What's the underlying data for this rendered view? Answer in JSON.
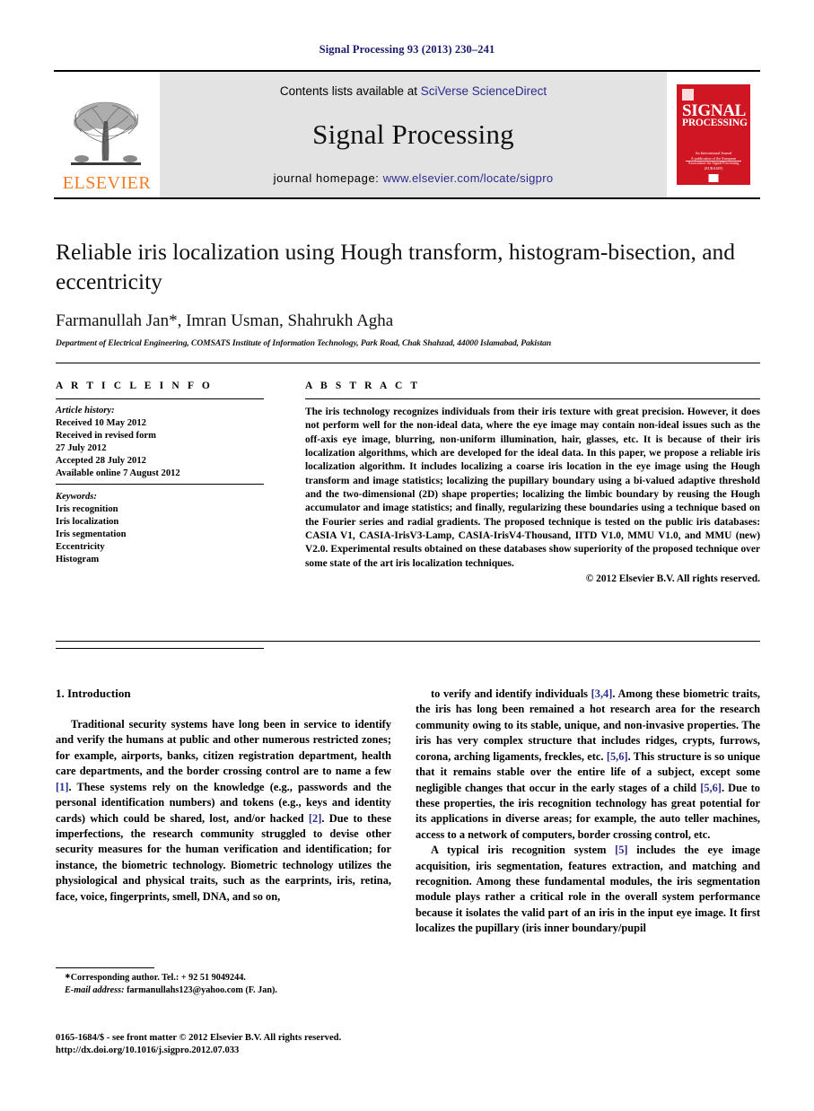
{
  "running_head": "Signal Processing 93 (2013) 230–241",
  "masthead": {
    "logo_word": "ELSEVIER",
    "contents_prefix": "Contents lists available at ",
    "contents_link": "SciVerse ScienceDirect",
    "journal_name": "Signal Processing",
    "homepage_prefix": "journal homepage: ",
    "homepage_url": "www.elsevier.com/locate/sigpro",
    "cover": {
      "line1": "SIGNAL",
      "line2": "PROCESSING",
      "subtitle": "An International Journal",
      "publisher": "A publication of the European Association for Signal Processing (EURASIP)"
    },
    "accent_orange": "#F47B20",
    "cover_red": "#cf1622",
    "link_blue": "#2b2b8f"
  },
  "title": "Reliable iris localization using Hough transform, histogram-bisection, and eccentricity",
  "authors": "Farmanullah Jan*, Imran Usman, Shahrukh Agha",
  "affiliation": "Department of Electrical Engineering, COMSATS Institute of Information Technology, Park Road, Chak Shahzad, 44000 Islamabad, Pakistan",
  "article_info": {
    "heading": "A R T I C L E  I N F O",
    "history_label": "Article history:",
    "history": [
      "Received 10 May 2012",
      "Received in revised form",
      "27 July 2012",
      "Accepted 28 July 2012",
      "Available online 7 August 2012"
    ],
    "keywords_label": "Keywords:",
    "keywords": [
      "Iris recognition",
      "Iris localization",
      "Iris segmentation",
      "Eccentricity",
      "Histogram"
    ]
  },
  "abstract": {
    "heading": "A B S T R A C T",
    "text": "The iris technology recognizes individuals from their iris texture with great precision. However, it does not perform well for the non-ideal data, where the eye image may contain non-ideal issues such as the off-axis eye image, blurring, non-uniform illumination, hair, glasses, etc. It is because of their iris localization algorithms, which are developed for the ideal data. In this paper, we propose a reliable iris localization algorithm. It includes localizing a coarse iris location in the eye image using the Hough transform and image statistics; localizing the pupillary boundary using a bi-valued adaptive threshold and the two-dimensional (2D) shape properties; localizing the limbic boundary by reusing the Hough accumulator and image statistics; and finally, regularizing these boundaries using a technique based on the Fourier series and radial gradients. The proposed technique is tested on the public iris databases: CASIA V1, CASIA-IrisV3-Lamp, CASIA-IrisV4-Thousand, IITD V1.0, MMU V1.0, and MMU (new) V2.0. Experimental results obtained on these databases show superiority of the proposed technique over some state of the art iris localization techniques.",
    "copyright": "© 2012 Elsevier B.V. All rights reserved."
  },
  "body": {
    "section_number_title": "1.  Introduction",
    "left_paragraphs": [
      {
        "runs": [
          {
            "t": "Traditional security systems have long been in service to identify and verify the humans at public and other numerous restricted zones; for example, airports, banks, citizen registration department, health care departments, and the border crossing control are to name a few "
          },
          {
            "t": "[1]",
            "ref": true
          },
          {
            "t": ". These systems rely on the knowledge (e.g., passwords and the personal identification numbers) and tokens (e.g., keys and identity cards) which could be shared, lost, and/or hacked "
          },
          {
            "t": "[2]",
            "ref": true
          },
          {
            "t": ". Due to these imperfections, the research community struggled to devise other security measures for the human verification and identification; for instance, the biometric technology. Biometric technology utilizes the physiological and physical traits, such as the earprints, iris, retina, face, voice, fingerprints, smell, DNA, and so on,"
          }
        ]
      }
    ],
    "right_paragraphs": [
      {
        "runs": [
          {
            "t": "to verify and identify individuals "
          },
          {
            "t": "[3,4]",
            "ref": true
          },
          {
            "t": ". Among these biometric traits, the iris has long been remained a hot research area for the research community owing to its stable, unique, and non-invasive properties. The iris has very complex structure that includes ridges, crypts, furrows, corona, arching ligaments, freckles, etc. "
          },
          {
            "t": "[5,6]",
            "ref": true
          },
          {
            "t": ". This structure is so unique that it remains stable over the entire life of a subject, except some negligible changes that occur in the early stages of a child "
          },
          {
            "t": "[5,6]",
            "ref": true
          },
          {
            "t": ". Due to these properties, the iris recognition technology has great potential for its applications in diverse areas; for example, the auto teller machines, access to a network of computers, border crossing control, etc."
          }
        ]
      },
      {
        "runs": [
          {
            "t": "A typical iris recognition system "
          },
          {
            "t": "[5]",
            "ref": true
          },
          {
            "t": " includes the eye image acquisition, iris segmentation, features extraction, and matching and recognition. Among these fundamental modules, the iris segmentation module plays rather a critical role in the overall system performance because it isolates the valid part of an iris in the input eye image. It first localizes the pupillary (iris inner boundary/pupil"
          }
        ]
      }
    ]
  },
  "footnote": {
    "corresponding": "Corresponding author. Tel.: + 92 51 9049244.",
    "email_label": "E-mail address:",
    "email": "farmanullahs123@yahoo.com (F. Jan)."
  },
  "imprint": {
    "line1": "0165-1684/$ - see front matter © 2012 Elsevier B.V. All rights reserved.",
    "line2": "http://dx.doi.org/10.1016/j.sigpro.2012.07.033"
  }
}
